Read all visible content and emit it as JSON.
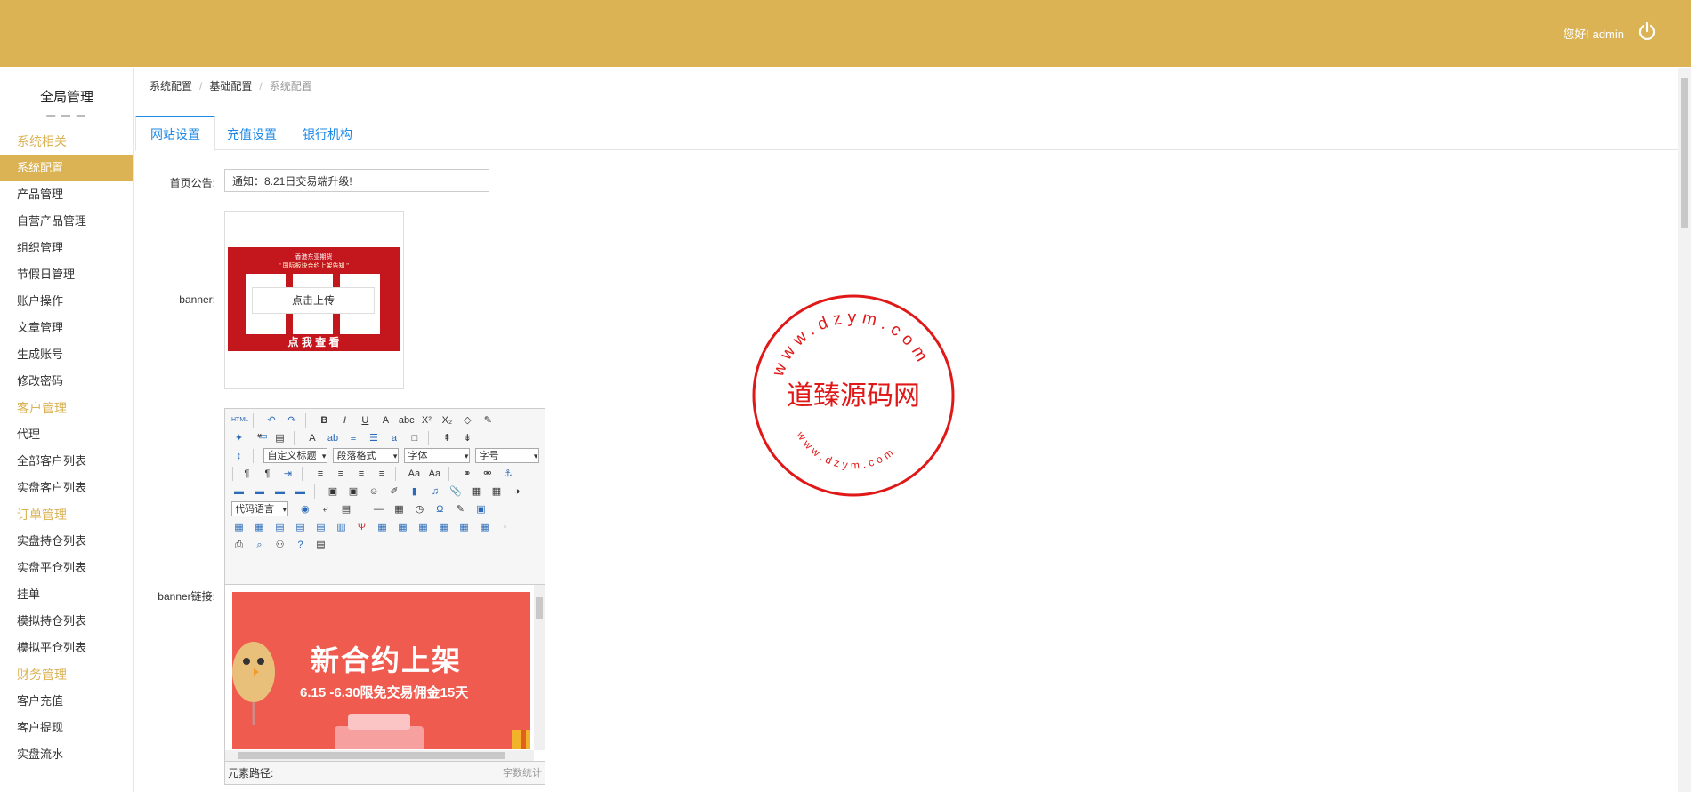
{
  "header": {
    "greeting": "您好! admin",
    "logout_icon": "power-icon",
    "background": "#dbb354"
  },
  "sidebar": {
    "title": "全局管理",
    "groups": [
      {
        "label": "系统相关",
        "items": [
          "系统配置",
          "产品管理",
          "自营产品管理",
          "组织管理",
          "节假日管理",
          "账户操作",
          "文章管理",
          "生成账号",
          "修改密码"
        ]
      },
      {
        "label": "客户管理",
        "items": [
          "代理",
          "全部客户列表",
          "实盘客户列表"
        ]
      },
      {
        "label": "订单管理",
        "items": [
          "实盘持仓列表",
          "实盘平仓列表",
          "挂单",
          "模拟持仓列表",
          "模拟平仓列表"
        ]
      },
      {
        "label": "财务管理",
        "items": [
          "客户充值",
          "客户提现",
          "实盘流水"
        ]
      }
    ],
    "active_item": "系统配置"
  },
  "breadcrumb": [
    "系统配置",
    "基础配置",
    "系统配置"
  ],
  "tabs": [
    "网站设置",
    "充值设置",
    "银行机构"
  ],
  "active_tab": "网站设置",
  "form": {
    "notice_label": "首页公告:",
    "notice_value": "通知：8.21日交易端升级!",
    "banner_label": "banner:",
    "upload_label": "点击上传",
    "banner_image": {
      "line1": "香港东亚期货",
      "line2": "\" 国际板块合约上架告知 \"",
      "cta": "点 我 查 看"
    },
    "banner_link_label": "banner链接:"
  },
  "editor": {
    "selects": {
      "custom_title": "自定义标题",
      "paragraph": "段落格式",
      "font": "字体",
      "size": "字号",
      "code_lang": "代码语言"
    },
    "content": {
      "headline": "新合约上架",
      "subline": "6.15 -6.30限免交易佣金15天"
    },
    "path_label": "元素路径:",
    "word_count": "字数统计"
  },
  "watermark": {
    "center": "道臻源码网",
    "top_ring": "www.dzym.com",
    "bottom_ring": "www.dzym.com",
    "color": "#e01818"
  }
}
